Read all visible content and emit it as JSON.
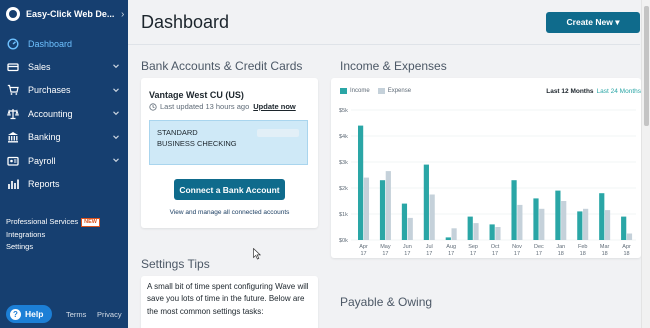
{
  "brand": {
    "name": "Easy-Click Web De..."
  },
  "nav": [
    {
      "key": "dashboard",
      "label": "Dashboard",
      "icon": "dashboard-icon",
      "has_chevron": false,
      "active": true
    },
    {
      "key": "sales",
      "label": "Sales",
      "icon": "sales-icon",
      "has_chevron": true
    },
    {
      "key": "purchases",
      "label": "Purchases",
      "icon": "cart-icon",
      "has_chevron": true
    },
    {
      "key": "accounting",
      "label": "Accounting",
      "icon": "scale-icon",
      "has_chevron": true
    },
    {
      "key": "banking",
      "label": "Banking",
      "icon": "bank-icon",
      "has_chevron": true
    },
    {
      "key": "payroll",
      "label": "Payroll",
      "icon": "payroll-icon",
      "has_chevron": true
    },
    {
      "key": "reports",
      "label": "Reports",
      "icon": "reports-icon",
      "has_chevron": false
    }
  ],
  "extra_links": {
    "professional_services": "Professional Services",
    "new_badge": "NEW",
    "integrations": "Integrations",
    "settings": "Settings"
  },
  "footer": {
    "help": "Help",
    "terms": "Terms",
    "privacy": "Privacy"
  },
  "header": {
    "title": "Dashboard",
    "create_new": "Create New ▾"
  },
  "bank_section": {
    "title": "Bank Accounts & Credit Cards",
    "bank_name": "Vantage West CU (US)",
    "last_updated": "Last updated 13 hours ago",
    "update_now": "Update now",
    "account_name": "STANDARD BUSINESS CHECKING",
    "connect_button": "Connect a Bank Account",
    "view_link": "View and manage all connected accounts"
  },
  "settings_tips": {
    "title": "Settings Tips",
    "text": "A small bit of time spent configuring Wave will save you lots of time in the future. Below are the most common settings tasks:"
  },
  "income_section": {
    "title": "Income & Expenses",
    "period_active": "Last 12 Months",
    "period_alt": "Last 24 Months"
  },
  "payable_section": {
    "title": "Payable & Owing"
  },
  "colors": {
    "income": "#2aa6a6",
    "expense": "#c5d1da",
    "sidebar": "#163f70",
    "primary_button": "#0f6b8c"
  },
  "chart_data": {
    "type": "bar",
    "title": "",
    "xlabel": "",
    "ylabel": "",
    "y_tick_labels": [
      "$0k",
      "$1k",
      "$2k",
      "$3k",
      "$4k",
      "$5k"
    ],
    "ylim": [
      0,
      5000
    ],
    "categories": [
      "Apr 17",
      "May 17",
      "Jun 17",
      "Jul 17",
      "Aug 17",
      "Sep 17",
      "Oct 17",
      "Nov 17",
      "Dec 17",
      "Jan 18",
      "Feb 18",
      "Mar 18",
      "Apr 18"
    ],
    "category_lines": [
      [
        "Apr",
        "17"
      ],
      [
        "May",
        "17"
      ],
      [
        "Jun",
        "17"
      ],
      [
        "Jul",
        "17"
      ],
      [
        "Aug",
        "17"
      ],
      [
        "Sep",
        "17"
      ],
      [
        "Oct",
        "17"
      ],
      [
        "Nov",
        "17"
      ],
      [
        "Dec",
        "17"
      ],
      [
        "Jan",
        "18"
      ],
      [
        "Feb",
        "18"
      ],
      [
        "Mar",
        "18"
      ],
      [
        "Apr",
        "18"
      ]
    ],
    "series": [
      {
        "name": "Income",
        "values": [
          4400,
          2300,
          1400,
          2900,
          100,
          900,
          600,
          2300,
          1600,
          1900,
          1100,
          1800,
          900
        ]
      },
      {
        "name": "Expense",
        "values": [
          2400,
          2650,
          850,
          1750,
          450,
          650,
          500,
          1350,
          1200,
          1500,
          1200,
          1150,
          250
        ]
      }
    ],
    "legend": "top-left",
    "grid": true
  }
}
